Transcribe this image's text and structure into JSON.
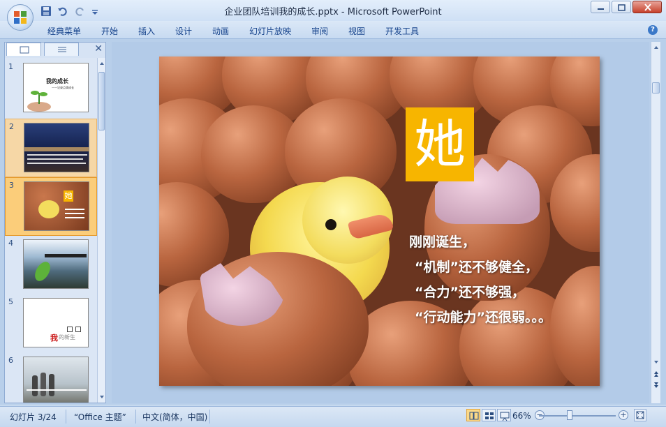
{
  "window": {
    "title": "企业团队培训我的成长.pptx - Microsoft PowerPoint"
  },
  "ribbon": {
    "tabs": [
      "经典菜单",
      "开始",
      "插入",
      "设计",
      "动画",
      "幻灯片放映",
      "审阅",
      "视图",
      "开发工具"
    ]
  },
  "thumbnails": [
    {
      "number": "1",
      "title": "我的成长",
      "subtitle": "——记录点滴成长"
    },
    {
      "number": "2"
    },
    {
      "number": "3",
      "char": "她"
    },
    {
      "number": "4"
    },
    {
      "number": "5",
      "text_a": "我",
      "text_b": "的新生"
    },
    {
      "number": "6"
    }
  ],
  "slide": {
    "big_char": "她",
    "lines": [
      "刚刚诞生，",
      "“机制”还不够健全，",
      "“合力”还不够强，",
      "“行动能力”还很弱。。。"
    ]
  },
  "status": {
    "slide_counter": "幻灯片 3/24",
    "theme": "“Office 主题”",
    "language": "中文(简体，中国)",
    "zoom": "66%"
  },
  "colors": {
    "accent": "#f7b500",
    "ribbon_text": "#15428b"
  }
}
